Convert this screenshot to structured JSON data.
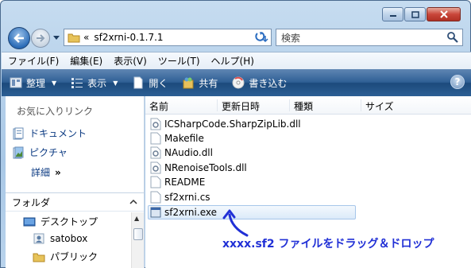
{
  "window": {
    "accent": "#2f5f95",
    "caption_buttons": [
      "minimize-icon",
      "maximize-icon",
      "close-icon"
    ]
  },
  "address": {
    "chevron": "«",
    "path": "sf2xrni-0.1.7.1"
  },
  "search": {
    "placeholder": "検索"
  },
  "menubar": {
    "items": [
      "ファイル(F)",
      "編集(E)",
      "表示(V)",
      "ツール(T)",
      "ヘルプ(H)"
    ]
  },
  "commandbar": {
    "organize": "整理",
    "views": "表示",
    "open": "開く",
    "share": "共有",
    "burn": "書き込む",
    "help": "?"
  },
  "navpane": {
    "favorites_title": "お気に入りリンク",
    "favorites": [
      "ドキュメント",
      "ピクチャ"
    ],
    "more": "詳細",
    "more_chev": "»",
    "folders_label": "フォルダ",
    "tree": [
      "デスクトップ",
      "satobox",
      "パブリック"
    ]
  },
  "filelist": {
    "columns": [
      "名前",
      "更新日時",
      "種類",
      "サイズ"
    ],
    "files": [
      {
        "name": "ICSharpCode.SharpZipLib.dll",
        "icon": "dll-file-icon"
      },
      {
        "name": "Makefile",
        "icon": "generic-file-icon"
      },
      {
        "name": "NAudio.dll",
        "icon": "dll-file-icon"
      },
      {
        "name": "NRenoiseTools.dll",
        "icon": "dll-file-icon"
      },
      {
        "name": "README",
        "icon": "generic-file-icon"
      },
      {
        "name": "sf2xrni.cs",
        "icon": "generic-file-icon"
      },
      {
        "name": "sf2xrni.exe",
        "icon": "exe-file-icon",
        "selected": true
      }
    ]
  },
  "annotation": {
    "text": "xxxx.sf2 ファイルをドラッグ＆ドロップ",
    "color": "#2130d6"
  }
}
